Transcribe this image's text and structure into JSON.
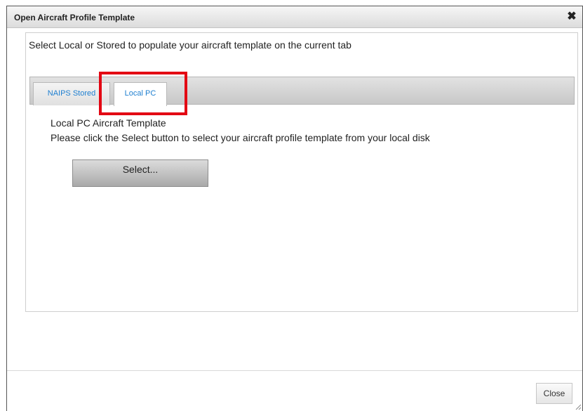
{
  "window": {
    "title": "Open Aircraft Profile Template",
    "close_glyph": "✖"
  },
  "content": {
    "instruction": "Select Local or Stored to populate your aircraft template on the current tab"
  },
  "tabs": [
    {
      "label": "NAIPS Stored",
      "active": false
    },
    {
      "label": "Local PC",
      "active": true
    }
  ],
  "panel": {
    "title": "Local PC Aircraft Template",
    "description": "Please click the Select button to select your aircraft profile template from your local disk",
    "select_label": "Select..."
  },
  "footer": {
    "close_label": "Close"
  },
  "colors": {
    "tab_text": "#1e7fd0",
    "highlight": "#e30613"
  },
  "icons": {
    "close": "close-icon",
    "resize": "resize-grip-icon"
  }
}
